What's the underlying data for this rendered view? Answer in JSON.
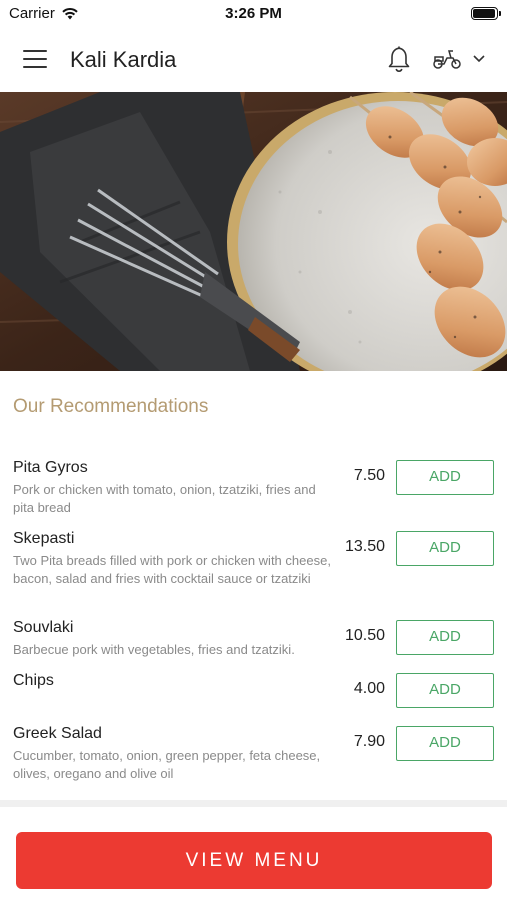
{
  "status_bar": {
    "carrier": "Carrier",
    "time": "3:26 PM",
    "battery_level": 0.95
  },
  "header": {
    "title": "Kali Kardia",
    "icons": [
      "menu-icon",
      "bell-icon",
      "scooter-icon",
      "chevron-down-icon"
    ]
  },
  "recommendations": {
    "title": "Our Recommendations",
    "items": [
      {
        "name": "Pita Gyros",
        "description": "Pork or chicken with tomato, onion, tzatziki, fries and pita bread",
        "price": "7.50",
        "button": "ADD"
      },
      {
        "name": "Skepasti",
        "description": "Two Pita breads filled with pork or chicken with cheese, bacon, salad and fries with cocktail sauce or tzatziki",
        "price": "13.50",
        "button": "ADD"
      },
      {
        "name": "Souvlaki",
        "description": "Barbecue pork with vegetables, fries and tzatziki.",
        "price": "10.50",
        "button": "ADD"
      },
      {
        "name": "Chips",
        "description": "",
        "price": "4.00",
        "button": "ADD"
      },
      {
        "name": "Greek Salad",
        "description": "Cucumber, tomato, onion, green pepper, feta cheese, olives, oregano and olive oil",
        "price": "7.90",
        "button": "ADD"
      }
    ]
  },
  "footer": {
    "view_menu_label": "VIEW MENU"
  },
  "colors": {
    "accent_gold": "#b49b72",
    "add_green": "#4aa666",
    "view_menu_red": "#ec3a32"
  }
}
